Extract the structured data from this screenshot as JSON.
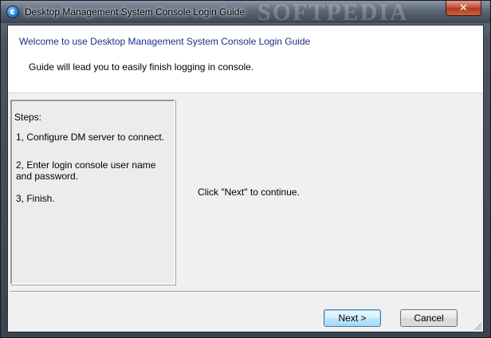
{
  "window": {
    "title": "Desktop Management System Console Login Guide",
    "watermark": "SOFTPEDIA",
    "close_glyph": "✕"
  },
  "header": {
    "title": "Welcome to use Desktop Management System Console Login Guide",
    "subtitle": "Guide will lead you to easily finish logging in console."
  },
  "steps": {
    "title": "Steps:",
    "items": [
      "1, Configure DM server to connect.",
      "2, Enter login console user name and password.",
      "3, Finish."
    ]
  },
  "main": {
    "message": "Click \"Next\" to continue."
  },
  "buttons": {
    "next_label": "Next >",
    "cancel_label": "Cancel"
  },
  "icons": {
    "app": "app-logo-icon",
    "close": "close-icon",
    "grip": "resize-grip-icon"
  },
  "colors": {
    "header_title": "#1c2f8a",
    "close_button": "#c6543d",
    "default_button_border": "#3c7fb1"
  }
}
